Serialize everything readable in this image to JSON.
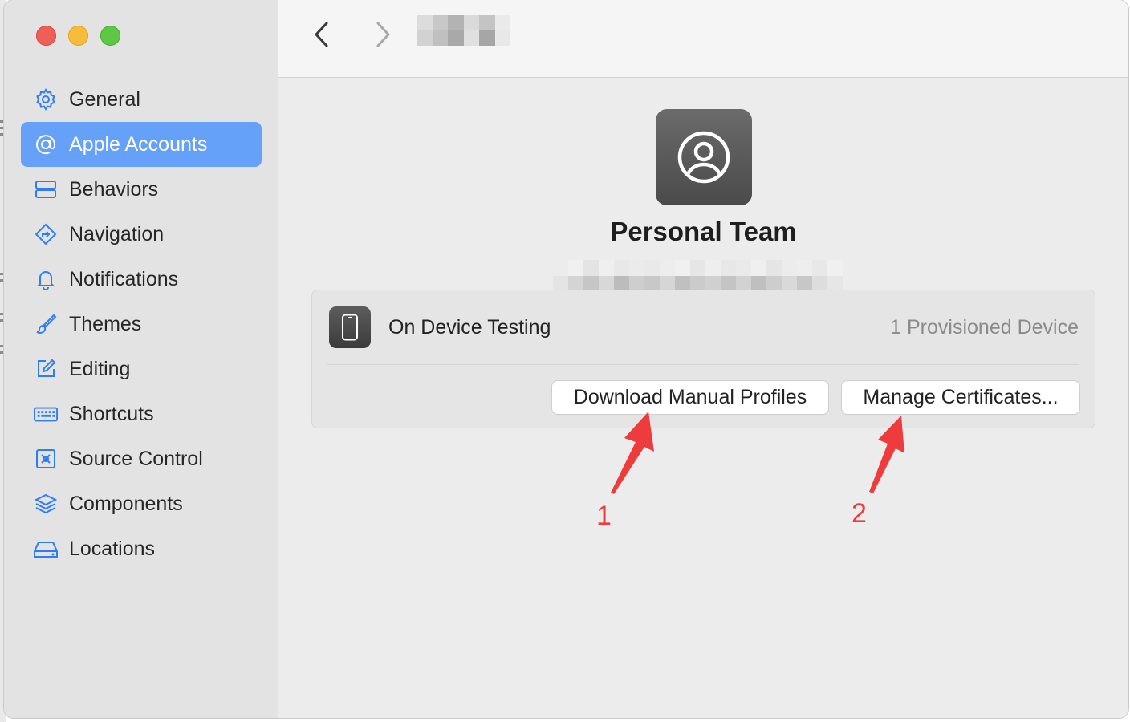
{
  "window": {
    "traffic_lights": [
      "close",
      "minimize",
      "zoom"
    ]
  },
  "sidebar": {
    "items": [
      {
        "label": "General",
        "icon": "gear-icon"
      },
      {
        "label": "Apple Accounts",
        "icon": "at-icon",
        "selected": true
      },
      {
        "label": "Behaviors",
        "icon": "behaviors-icon"
      },
      {
        "label": "Navigation",
        "icon": "navigation-icon"
      },
      {
        "label": "Notifications",
        "icon": "bell-icon"
      },
      {
        "label": "Themes",
        "icon": "paintbrush-icon"
      },
      {
        "label": "Editing",
        "icon": "edit-icon"
      },
      {
        "label": "Shortcuts",
        "icon": "keyboard-icon"
      },
      {
        "label": "Source Control",
        "icon": "source-control-icon"
      },
      {
        "label": "Components",
        "icon": "layers-icon"
      },
      {
        "label": "Locations",
        "icon": "drive-icon"
      }
    ]
  },
  "toolbar": {
    "back_icon": "chevron-left-icon",
    "forward_icon": "chevron-right-icon"
  },
  "team": {
    "name": "Personal Team",
    "avatar_icon": "person-circle-icon"
  },
  "testing": {
    "label": "On Device Testing",
    "value": "1 Provisioned Device",
    "icon": "iphone-icon",
    "download_button": "Download Manual Profiles",
    "manage_button": "Manage Certificates..."
  },
  "annotations": {
    "first": "1",
    "second": "2",
    "color": "#ee3b3b"
  },
  "colors": {
    "accent": "#66a1f9",
    "icon_blue": "#2f7cf6"
  }
}
